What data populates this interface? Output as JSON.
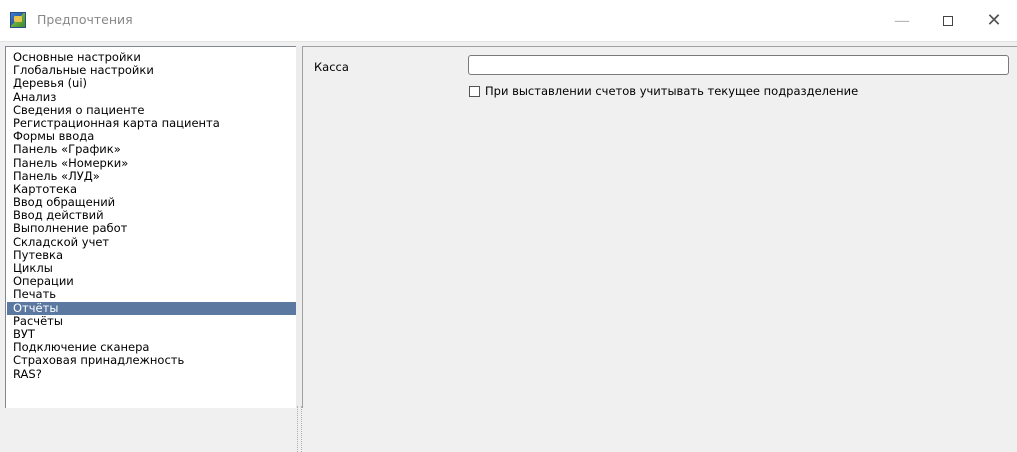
{
  "window": {
    "title": "Предпочтения",
    "icon": "app-icon",
    "buttons": {
      "minimize": "—",
      "maximize": "□",
      "close": "✕"
    }
  },
  "tree": {
    "selected_index": 19,
    "items": [
      "Основные настройки",
      "Глобальные настройки",
      "Деревья (ui)",
      "Анализ",
      "Сведения о пациенте",
      "Регистрационная карта пациента",
      "Формы ввода",
      "Панель «График»",
      "Панель «Номерки»",
      "Панель «ЛУД»",
      "Картотека",
      "Ввод обращений",
      "Ввод действий",
      "Выполнение работ",
      "Складской учет",
      "Путевка",
      "Циклы",
      "Операции",
      "Печать",
      "Отчёты",
      "Расчёты",
      "ВУТ",
      "Подключение сканера",
      "Страховая принадлежность",
      "RAS?"
    ]
  },
  "panel": {
    "kassa_label": "Касса",
    "kassa_value": "",
    "checkbox_label": "При выставлении счетов учитывать текущее подразделение",
    "checkbox_checked": false
  },
  "colors": {
    "selection": "#5a78a0",
    "background": "#f0f0f0"
  }
}
